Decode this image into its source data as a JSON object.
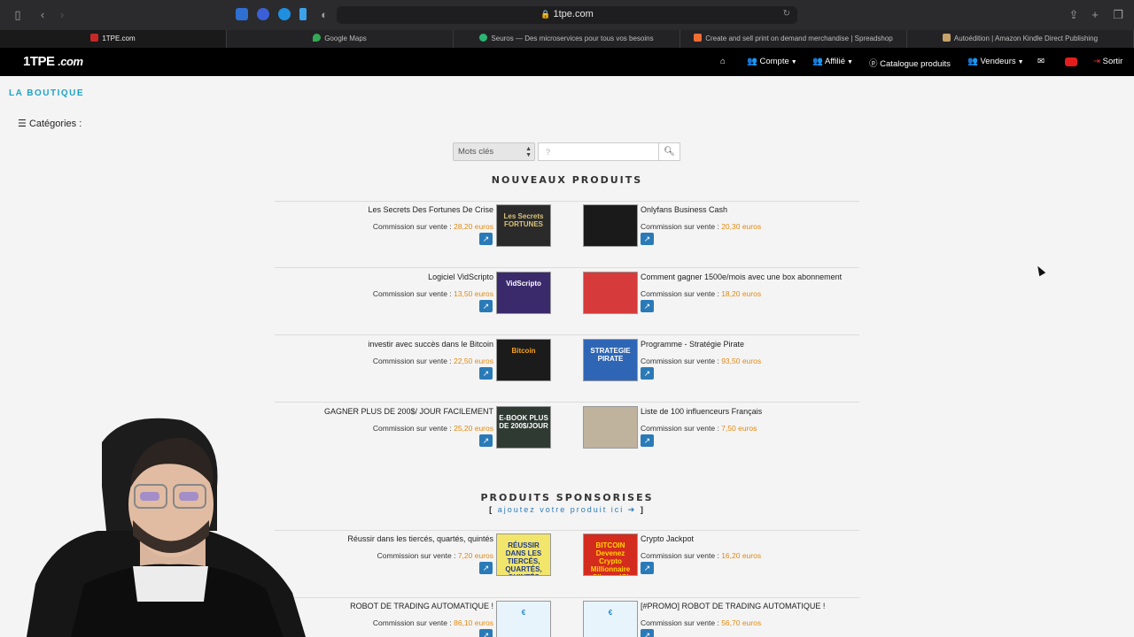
{
  "browser": {
    "url": "1tpe.com",
    "tabs": [
      {
        "label": "1TPE.com",
        "icon_color": "#c62828"
      },
      {
        "label": "Google Maps",
        "icon_color": "#34a853"
      },
      {
        "label": "Seuros — Des microservices pour tous vos besoins",
        "icon_color": "#2bb673"
      },
      {
        "label": "Create and sell print on demand merchandise | Spreadshop",
        "icon_color": "#ef6c33"
      },
      {
        "label": "Autoédition | Amazon Kindle Direct Publishing",
        "icon_color": "#c7a26b"
      }
    ]
  },
  "nav": {
    "logo_main": "1TPE",
    "logo_suffix": ".com",
    "items": [
      {
        "label": "Compte"
      },
      {
        "label": "Affilié"
      },
      {
        "label": "Catalogue produits"
      },
      {
        "label": "Vendeurs"
      },
      {
        "label": "Sortir"
      }
    ]
  },
  "page": {
    "section_label": "LA BOUTIQUE",
    "categories_label": "Catégories :",
    "search": {
      "select_value": "Mots clés",
      "placeholder": "?"
    },
    "new_products_title": "NOUVEAUX PRODUITS",
    "sponsored_title": "PRODUITS SPONSORISES",
    "add_product_link": "ajoutez votre produit ici",
    "commission_label": "Commission sur vente :"
  },
  "new_products": [
    {
      "title": "Les Secrets Des Fortunes De Crise",
      "price": "28,20 euros",
      "thumb_text": "Les Secrets FORTUNES",
      "thumb_bg": "#2a2a2a",
      "thumb_fg": "#d9c27a"
    },
    {
      "title": "Onlyfans Business Cash",
      "price": "20,30 euros",
      "thumb_text": "",
      "thumb_bg": "#1a1a1a",
      "thumb_fg": "#ffffff"
    },
    {
      "title": "Logiciel VidScripto",
      "price": "13,50 euros",
      "thumb_text": "VidScripto",
      "thumb_bg": "#3b2a6b",
      "thumb_fg": "#ffffff"
    },
    {
      "title": "Comment gagner 1500e/mois avec une box abonnement",
      "price": "18,20 euros",
      "thumb_text": "",
      "thumb_bg": "#d63a3a",
      "thumb_fg": "#ffffff"
    },
    {
      "title": "investir avec succès dans le Bitcoin",
      "price": "22,50 euros",
      "thumb_text": "Bitcoin",
      "thumb_bg": "#1b1b1b",
      "thumb_fg": "#f7a21b"
    },
    {
      "title": "Programme - Stratégie Pirate",
      "price": "93,50 euros",
      "thumb_text": "STRATEGIE PIRATE",
      "thumb_bg": "#2e66b5",
      "thumb_fg": "#ffffff"
    },
    {
      "title": "GAGNER PLUS DE 200$/ JOUR FACILEMENT",
      "price": "25,20 euros",
      "thumb_text": "E-BOOK PLUS DE 200$/JOUR",
      "thumb_bg": "#2f3a33",
      "thumb_fg": "#ffffff"
    },
    {
      "title": "Liste de 100 influenceurs Français",
      "price": "7,50 euros",
      "thumb_text": "",
      "thumb_bg": "#bfb39e",
      "thumb_fg": "#ffffff"
    }
  ],
  "sponsored_products": [
    {
      "title": "Réussir dans les tiercés, quartés, quintés",
      "price": "7,20 euros",
      "thumb_text": "RÉUSSIR DANS LES TIERCÉS, QUARTÉS, QUINTÉS",
      "thumb_bg": "#f2e56b",
      "thumb_fg": "#1f3a8a"
    },
    {
      "title": "Crypto Jackpot",
      "price": "16,20 euros",
      "thumb_text": "BITCOIN Devenez Crypto Millionnaire Cliquez ICI",
      "thumb_bg": "#d42b1f",
      "thumb_fg": "#ffd400"
    },
    {
      "title": "ROBOT DE TRADING AUTOMATIQUE !",
      "price": "86,10 euros",
      "thumb_text": "€",
      "thumb_bg": "#e8f4fb",
      "thumb_fg": "#1e88c9"
    },
    {
      "title": "[#PROMO] ROBOT DE TRADING AUTOMATIQUE !",
      "price": "56,70 euros",
      "thumb_text": "€",
      "thumb_bg": "#e8f4fb",
      "thumb_fg": "#1e88c9"
    }
  ]
}
